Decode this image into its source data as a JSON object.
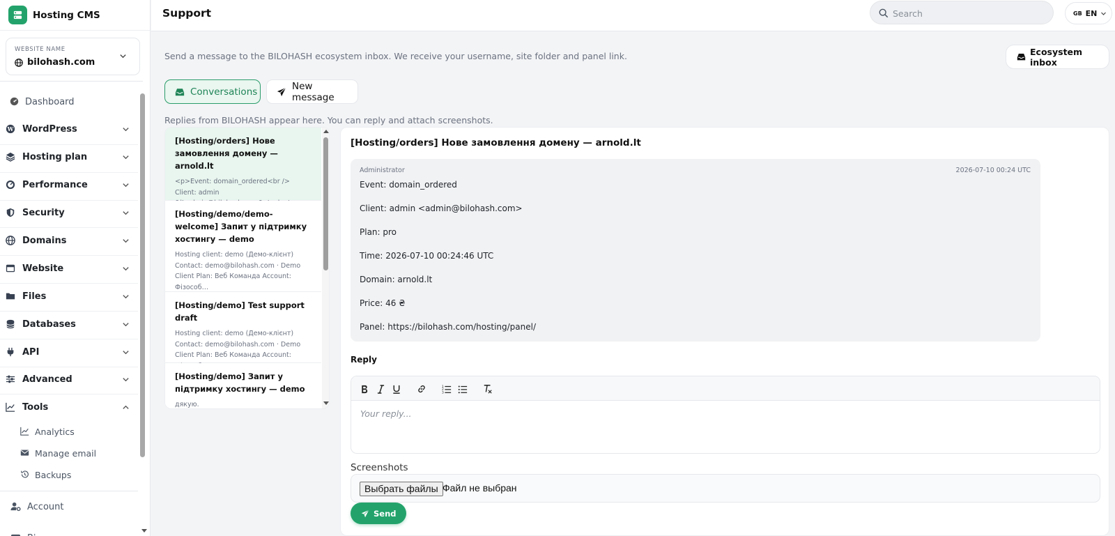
{
  "app": {
    "name": "Hosting CMS"
  },
  "website": {
    "label": "WEBSITE NAME",
    "name": "bilohash.com"
  },
  "sidebar": {
    "dashboard": "Dashboard",
    "items": [
      {
        "label": "WordPress",
        "icon": "wordpress-icon"
      },
      {
        "label": "Hosting plan",
        "icon": "layers-icon"
      },
      {
        "label": "Performance",
        "icon": "gauge-icon"
      },
      {
        "label": "Security",
        "icon": "shield-icon"
      },
      {
        "label": "Domains",
        "icon": "globe-icon"
      },
      {
        "label": "Website",
        "icon": "browser-icon"
      },
      {
        "label": "Files",
        "icon": "folder-icon"
      },
      {
        "label": "Databases",
        "icon": "database-icon"
      },
      {
        "label": "API",
        "icon": "plug-icon"
      },
      {
        "label": "Advanced",
        "icon": "sliders-icon"
      },
      {
        "label": "Tools",
        "icon": "chart-icon"
      }
    ],
    "tools_sub": [
      {
        "label": "Analytics",
        "icon": "analytics-icon"
      },
      {
        "label": "Manage email",
        "icon": "mail-icon"
      },
      {
        "label": "Backups",
        "icon": "history-icon"
      }
    ],
    "account": "Account",
    "next_partial": "Bi"
  },
  "header": {
    "title": "Support",
    "search_placeholder": "Search",
    "lang_flag": "GB",
    "lang_code": "EN"
  },
  "main": {
    "intro": "Send a message to the BILOHASH ecosystem inbox. We receive your username, site folder and panel link.",
    "inbox_button": "Ecosystem inbox",
    "tabs": [
      {
        "label": "Conversations",
        "active": true
      },
      {
        "label": "New message",
        "active": false
      }
    ],
    "replies_note": "Replies from BILOHASH appear here. You can reply and attach screenshots."
  },
  "conversations": [
    {
      "title": "[Hosting/orders] Нове замовлення домену — arnold.lt",
      "preview": "<p>Event: domain_ordered<br /> Client: admin &lt;admin@bilohash.com&gt;<br /> Plan: pro<br /> Time: 2026-07-10…",
      "active": true
    },
    {
      "title": "[Hosting/demo/demo-welcome] Запит у підтримку хостингу — demo",
      "preview": "Hosting client: demo (Демо-клієнт) Contact: demo@bilohash.com · Demo Client Plan: Веб Команда Account: Фізособ…",
      "active": false
    },
    {
      "title": "[Hosting/demo] Test support draft",
      "preview": "Hosting client: demo (Демо-клієнт) Contact: demo@bilohash.com · Demo Client Plan: Веб Команда Account: Фізособ…",
      "active": false
    },
    {
      "title": "[Hosting/demo] Запит у підтримку хостингу — demo",
      "preview": "дякую.",
      "active": false
    }
  ],
  "thread": {
    "title": "[Hosting/orders] Нове замовлення домену — arnold.lt",
    "message": {
      "author": "Administrator",
      "date": "2026-07-10 00:24 UTC",
      "lines": [
        "Event: domain_ordered",
        "Client: admin <admin@bilohash.com>",
        "Plan: pro",
        "Time: 2026-07-10 00:24:46 UTC",
        "Domain: arnold.lt",
        "Price: 46 ₴",
        "Panel: https://bilohash.com/hosting/panel/"
      ]
    },
    "reply_label": "Reply",
    "reply_placeholder": "Your reply...",
    "screenshots_label": "Screenshots",
    "file_button": "Выбрать файлы",
    "file_status": "Файл не выбран",
    "send_label": "Send"
  },
  "colors": {
    "accent": "#23a36b",
    "active_bg": "#e8f6ef"
  }
}
